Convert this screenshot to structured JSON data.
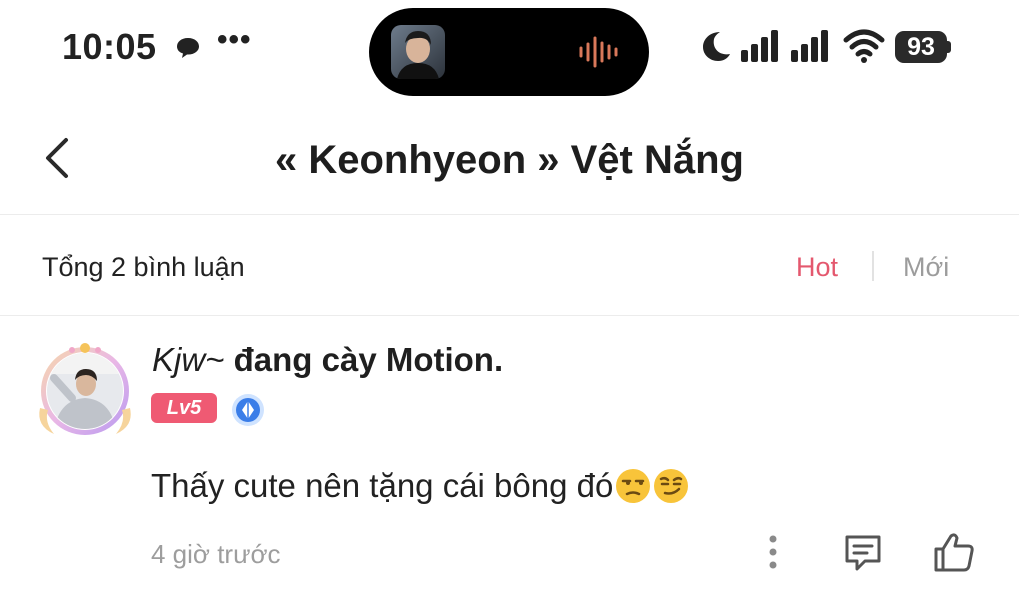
{
  "status_bar": {
    "time": "10:05",
    "more_dots": "•••",
    "battery": "93",
    "icons": [
      "chat-bubble-icon",
      "voice-wave-icon",
      "moon-icon",
      "signal-icon",
      "signal-icon",
      "wifi-icon",
      "battery-icon"
    ]
  },
  "header": {
    "title": "« Keonhyeon » Vệt Nắng",
    "back_icon": "chevron-left-icon"
  },
  "comments_summary": {
    "total_label": "Tổng 2 bình luận",
    "sort_hot": "Hot",
    "sort_new": "Mới",
    "active_sort": "Hot",
    "accent_color": "#e4586e"
  },
  "comment": {
    "nickname": "Kjw~",
    "status": "đang cày Motion.",
    "level": "Lv5",
    "text": "Thấy cute nên tặng cái bông đó",
    "emojis": [
      "unamused-face",
      "smirking-face"
    ],
    "time_ago": "4 giờ trước",
    "actions": [
      "more-vertical-icon",
      "reply-comment-icon",
      "thumbs-up-icon"
    ]
  }
}
